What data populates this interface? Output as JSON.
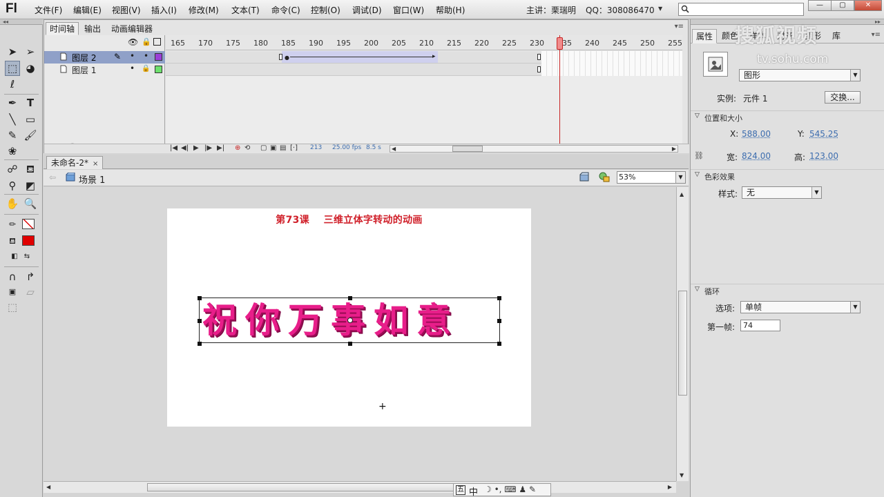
{
  "app": {
    "logo": "Fl",
    "menu": [
      "文件(F)",
      "编辑(E)",
      "视图(V)",
      "插入(I)",
      "修改(M)",
      "文本(T)",
      "命令(C)",
      "控制(O)",
      "调试(D)",
      "窗口(W)",
      "帮助(H)"
    ],
    "host_info": "主讲：栗瑞明",
    "qq_info": "QQ：308086470",
    "window_buttons": [
      "—",
      "▢",
      "✕"
    ]
  },
  "timeline": {
    "tabs": [
      "时间轴",
      "输出",
      "动画编辑器"
    ],
    "ruler": [
      "165",
      "170",
      "175",
      "180",
      "185",
      "190",
      "195",
      "200",
      "205",
      "210",
      "215",
      "220",
      "225",
      "230",
      "235",
      "240",
      "245",
      "250",
      "255"
    ],
    "layers": [
      {
        "name": "图层 2",
        "color": "#9b3fd8",
        "selected": true
      },
      {
        "name": "图层 1",
        "color": "#6de06d",
        "selected": false
      }
    ],
    "current_frame": "213",
    "fps": "25.00 fps",
    "time": "8.5 s"
  },
  "document": {
    "tab_title": "未命名-2*",
    "tab_close": "×",
    "scene": "场景 1",
    "zoom": "53%",
    "stage_title": "第73课    三维立体字转动的动画",
    "stage_text": "祝你万事如意",
    "stage_text_color": "#e81e8a"
  },
  "ime": {
    "mode": "中",
    "extra": "☽ •, ⌨ ♟ ✎"
  },
  "properties": {
    "tabs": [
      "属性",
      "颜色",
      "样本",
      "对齐",
      "变形",
      "库"
    ],
    "watermark": "搜狐视频",
    "watermark_url": "tv.sohu.com",
    "symbol_type": "图形",
    "instance_label": "实例:",
    "instance_name": "元件 1",
    "swap_button": "交换...",
    "section_position": "位置和大小",
    "x_label": "X:",
    "x_value": "588.00",
    "y_label": "Y:",
    "y_value": "545.25",
    "w_label": "宽:",
    "w_value": "824.00",
    "h_label": "高:",
    "h_value": "123.00",
    "section_color": "色彩效果",
    "style_label": "样式:",
    "style_value": "无",
    "section_loop": "循环",
    "option_label": "选项:",
    "option_value": "单帧",
    "first_frame_label": "第一帧:",
    "first_frame_value": "74"
  }
}
